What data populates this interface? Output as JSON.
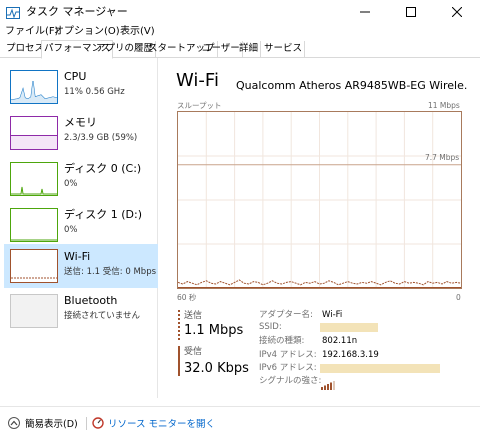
{
  "window": {
    "title": "タスク マネージャー"
  },
  "menu": [
    "ファイル(F)",
    "オプション(O)",
    "表示(V)"
  ],
  "tabs": [
    "プロセス",
    "パフォーマンス",
    "アプリの履歴",
    "スタートアップ",
    "ユーザー",
    "詳細",
    "サービス"
  ],
  "active_tab": "パフォーマンス",
  "sidebar": {
    "items": [
      {
        "name": "CPU",
        "sub": "11%  0.56 GHz",
        "color": "#1174c4"
      },
      {
        "name": "メモリ",
        "sub": "2.3/3.9 GB (59%)",
        "color": "#8e2aa8"
      },
      {
        "name": "ディスク 0 (C:)",
        "sub": "0%",
        "color": "#4da60c"
      },
      {
        "name": "ディスク 1 (D:)",
        "sub": "0%",
        "color": "#4da60c"
      },
      {
        "name": "Wi-Fi",
        "sub": "送信: 1.1  受信: 0 Mbps",
        "color": "#a0522d",
        "selected": true
      },
      {
        "name": "Bluetooth",
        "sub": "接続されていません",
        "color": "#a0a0a0"
      }
    ]
  },
  "main": {
    "title": "Wi-Fi",
    "adapter": "Qualcomm Atheros AR9485WB-EG Wirele...",
    "graph_label": "スループット",
    "graph_max": "11 Mbps",
    "graph_mid": "7.7 Mbps",
    "x_left": "60 秒",
    "x_right": "0"
  },
  "stats": {
    "send_label": "送信",
    "send_value": "1.1 Mbps",
    "recv_label": "受信",
    "recv_value": "32.0 Kbps"
  },
  "props": {
    "adapter_k": "アダプター名:",
    "adapter_v": "Wi-Fi",
    "ssid_k": "SSID:",
    "type_k": "接続の種類:",
    "type_v": "802.11n",
    "ipv4_k": "IPv4 アドレス:",
    "ipv4_v": "192.168.3.19",
    "ipv6_k": "IPv6 アドレス:",
    "signal_k": "シグナルの強さ:"
  },
  "bottom": {
    "fewer": "簡易表示(D)",
    "resmon": "リソース モニターを開く"
  },
  "chart_data": {
    "type": "line",
    "series": [
      {
        "values": [
          0.35,
          0.25,
          0.4,
          0.3,
          0.2,
          0.35,
          0.45,
          0.3,
          0.25,
          0.4,
          0.3,
          0.2,
          0.35,
          0.5,
          0.3,
          0.25,
          0.4,
          0.35,
          0.2,
          0.3,
          0.45,
          0.3,
          0.25,
          0.35,
          0.4,
          0.3,
          0.2,
          0.35,
          0.3,
          0.4,
          0.25,
          0.3,
          0.45,
          0.35,
          0.2,
          0.3,
          0.4,
          0.3,
          0.25,
          0.35,
          0.3,
          0.4,
          0.3,
          0.2,
          0.35,
          0.45,
          0.3,
          0.25,
          0.4,
          0.3,
          0.35,
          0.3,
          0.2,
          0.4,
          0.3,
          0.35,
          0.25,
          0.4,
          0.3,
          0.35,
          0.3
        ]
      },
      {
        "values": [
          0.03,
          0.03,
          0.03,
          0.03,
          0.03,
          0.03,
          0.03,
          0.03,
          0.03,
          0.03,
          0.03,
          0.03,
          0.03,
          0.03,
          0.03,
          0.03,
          0.03,
          0.03,
          0.03,
          0.03,
          0.03,
          0.03,
          0.03,
          0.03,
          0.03,
          0.03,
          0.03,
          0.03,
          0.03,
          0.03,
          0.03,
          0.03,
          0.03,
          0.03,
          0.03,
          0.03,
          0.03,
          0.03,
          0.03,
          0.03,
          0.03,
          0.03,
          0.03,
          0.03,
          0.03,
          0.03,
          0.03,
          0.03,
          0.03,
          0.03,
          0.03,
          0.03,
          0.03,
          0.03,
          0.03,
          0.03,
          0.03,
          0.03,
          0.03,
          0.03,
          0.03
        ]
      }
    ],
    "ylim": [
      0,
      11
    ],
    "xlim": [
      60,
      0
    ],
    "grid": true
  }
}
